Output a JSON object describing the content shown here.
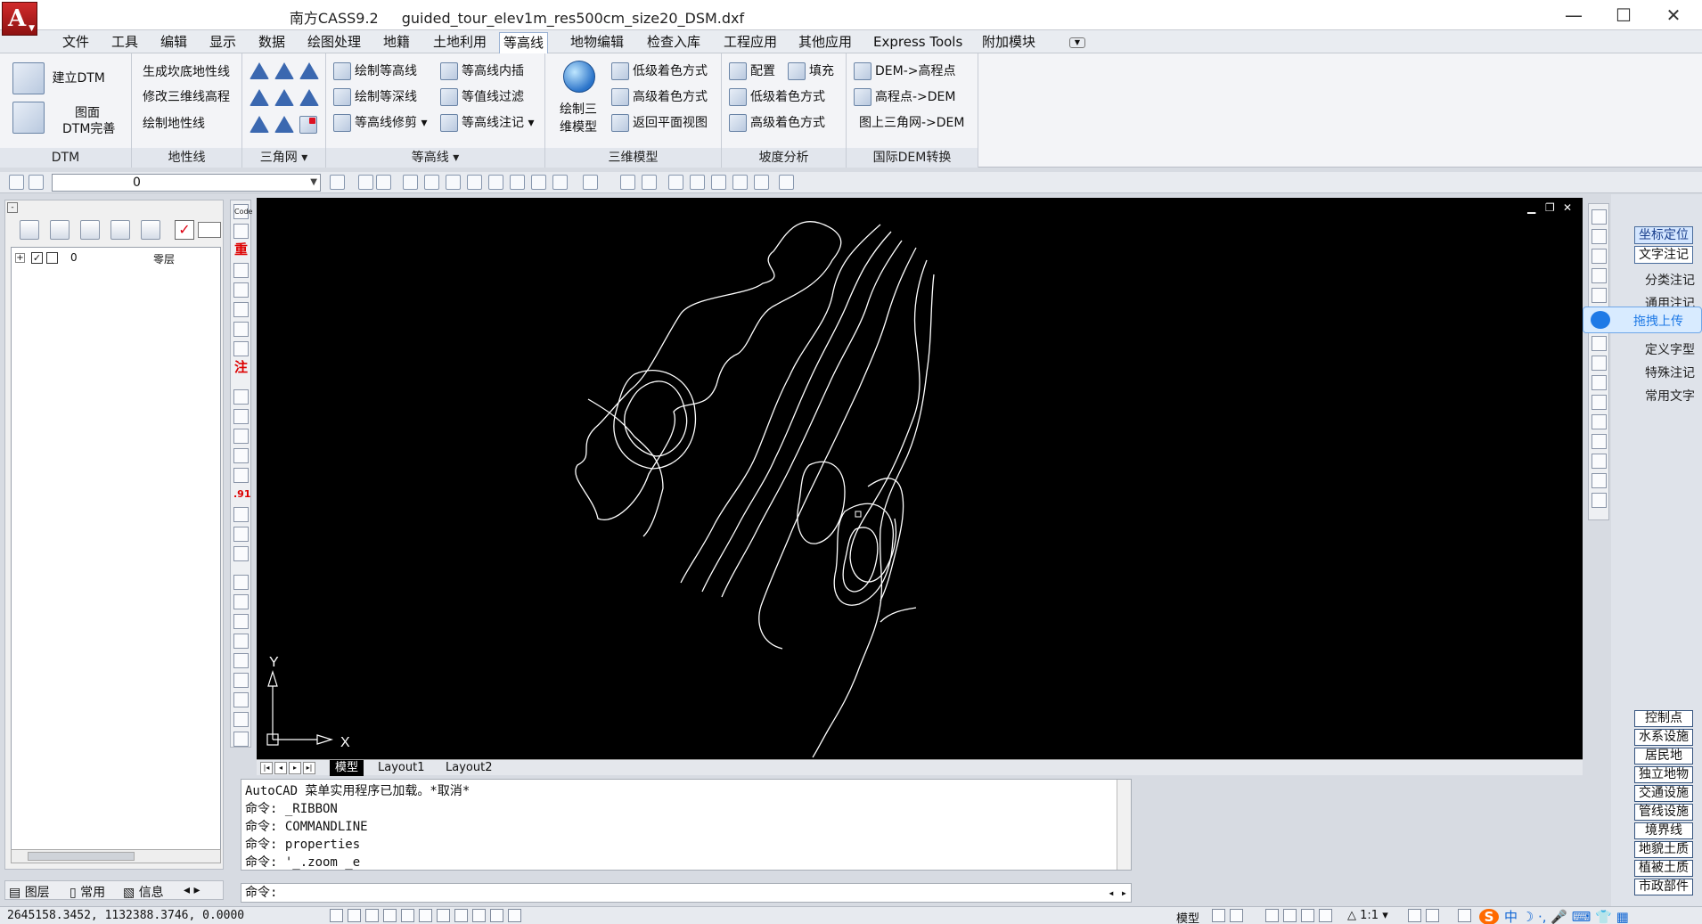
{
  "titlebar": {
    "app_name": "南方CASS9.2",
    "file_name": "guided_tour_elev1m_res500cm_size20_DSM.dxf",
    "minimize": "—",
    "maximize": "☐",
    "close": "✕"
  },
  "menu": [
    "文件",
    "工具",
    "编辑",
    "显示",
    "数据",
    "绘图处理",
    "地籍",
    "土地利用",
    "等高线",
    "地物编辑",
    "检查入库",
    "工程应用",
    "其他应用",
    "Express Tools",
    "附加模块"
  ],
  "active_menu": "等高线",
  "ribbon": {
    "dtm": {
      "title": "DTM",
      "build": "建立DTM",
      "improve_1": "图面",
      "improve_2": "DTM完善"
    },
    "terrain": {
      "title": "地性线",
      "items": [
        "生成坎底地性线",
        "修改三维线高程",
        "绘制地性线"
      ]
    },
    "tin": {
      "title": "三角网"
    },
    "contour": {
      "title": "等高线",
      "col1": [
        "绘制等高线",
        "绘制等深线",
        "等高线修剪"
      ],
      "col2": [
        "等高线内插",
        "等值线过滤",
        "等高线注记"
      ]
    },
    "model3d": {
      "title": "三维模型",
      "draw_1": "绘制三",
      "draw_2": "维模型",
      "items": [
        "低级着色方式",
        "高级着色方式",
        "返回平面视图"
      ]
    },
    "slope": {
      "title": "坡度分析",
      "config": "配置",
      "fill": "填充",
      "items": [
        "低级着色方式",
        "高级着色方式"
      ]
    },
    "dem": {
      "title": "国际DEM转换",
      "items": [
        "DEM->高程点",
        "高程点->DEM",
        "图上三角网->DEM"
      ]
    }
  },
  "toolbar": {
    "layer_value": "0"
  },
  "left_palette": {
    "layer_name": "0",
    "layer_desc": "零层",
    "tabs": [
      "图层",
      "常用",
      "信息"
    ]
  },
  "left_vtool": {
    "zhong": "重",
    "zhu": "注",
    "num": ".91",
    "code": "Code"
  },
  "canvas": {
    "axis_y": "Y",
    "axis_x": "X"
  },
  "layout_tabs": [
    "模型",
    "Layout1",
    "Layout2"
  ],
  "command": {
    "history": [
      "AutoCAD 菜单实用程序已加载。*取消*",
      "命令: _RIBBON",
      "命令: COMMANDLINE",
      "命令: properties",
      "命令: '_.zoom _e"
    ],
    "prompt": "命令:"
  },
  "right_palette": {
    "top": [
      "坐标定位",
      "文字注记"
    ],
    "mid": [
      "分类注记",
      "通用注记",
      "定义字型",
      "特殊注记",
      "常用文字"
    ],
    "upload": "拖拽上传",
    "bottom": [
      "控制点",
      "水系设施",
      "居民地",
      "独立地物",
      "交通设施",
      "管线设施",
      "境界线",
      "地貌土质",
      "植被土质",
      "市政部件"
    ]
  },
  "status": {
    "coords": "2645158.3452, 1132388.3746, 0.0000",
    "model": "模型",
    "scale": "1:1",
    "ime": "中"
  }
}
